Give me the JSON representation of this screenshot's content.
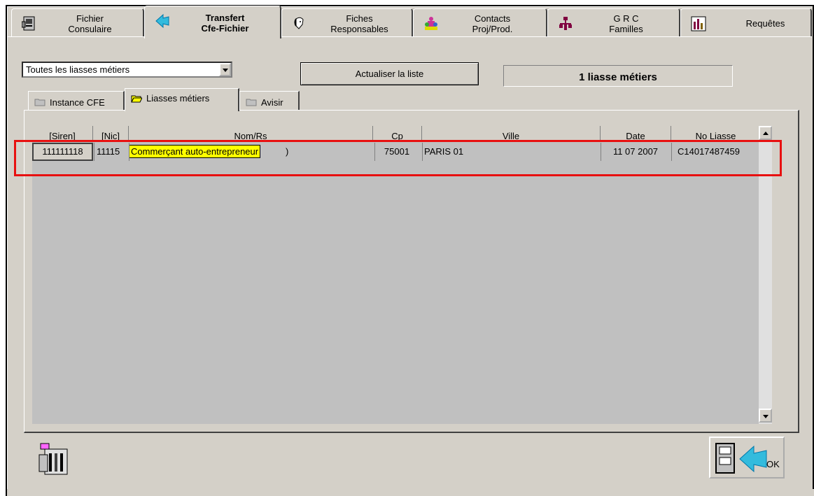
{
  "top_tabs": [
    {
      "label": "Fichier\nConsulaire",
      "icon": "card-file-icon",
      "active": false
    },
    {
      "label": "Transfert\nCfe-Fichier",
      "icon": "transfer-arrow-icon",
      "active": true
    },
    {
      "label": "Fiches\nResponsables",
      "icon": "person-face-icon",
      "active": false
    },
    {
      "label": "Contacts\nProj/Prod.",
      "icon": "group-people-icon",
      "active": false
    },
    {
      "label": "G R C\nFamilles",
      "icon": "family-tree-icon",
      "active": false
    },
    {
      "label": "Requêtes",
      "icon": "bar-chart-icon",
      "active": false
    }
  ],
  "filter": {
    "selected": "Toutes les liasses métiers"
  },
  "refresh_button": "Actualiser la liste",
  "counter": "1 liasse métiers",
  "inner_tabs": [
    {
      "label": "Instance CFE",
      "active": false
    },
    {
      "label": "Liasses métiers",
      "active": true
    },
    {
      "label": "Avisir",
      "active": false
    }
  ],
  "grid": {
    "columns": [
      "[Siren]",
      "[Nic]",
      "Nom/Rs",
      "Cp",
      "Ville",
      "Date",
      "No Liasse"
    ],
    "rows": [
      {
        "siren": "111111118",
        "nic": "11115",
        "nom": "Commerçant auto-entrepreneur",
        "nom_tail": ")",
        "cp": "75001",
        "ville": "PARIS 01",
        "date": "11 07 2007",
        "liasse": "C14017487459"
      }
    ]
  },
  "ok_button": "OK",
  "colors": {
    "highlight_yellow": "#ffff00",
    "annotation_red": "#e81010",
    "window_gray": "#d4d0c8",
    "grid_gray": "#c0c0c0"
  }
}
